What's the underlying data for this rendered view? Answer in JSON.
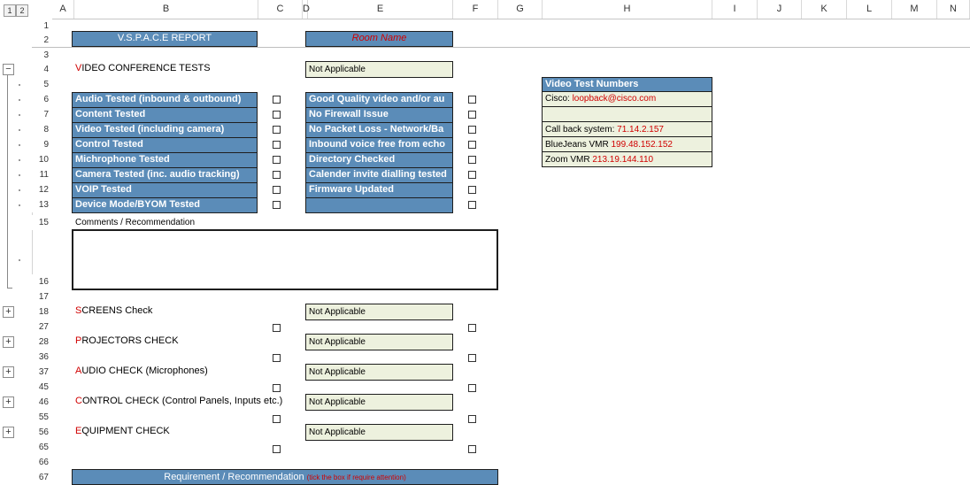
{
  "outline_levels": [
    "1",
    "2"
  ],
  "columns": [
    "A",
    "B",
    "C",
    "D",
    "E",
    "F",
    "G",
    "H",
    "I",
    "J",
    "K",
    "L",
    "M",
    "N"
  ],
  "rows": [
    "1",
    "2",
    "3",
    "4",
    "5",
    "6",
    "7",
    "8",
    "9",
    "10",
    "11",
    "12",
    "13",
    "15",
    "16",
    "17",
    "18",
    "27",
    "28",
    "36",
    "37",
    "45",
    "46",
    "55",
    "56",
    "65",
    "66",
    "67"
  ],
  "report": {
    "title": "V.S.P.A.C.E REPORT",
    "room_name": "Room Name"
  },
  "video_conference": {
    "first_letter": "V",
    "rest": "IDEO CONFERENCE TESTS",
    "status": "Not Applicable",
    "left_items": [
      "Audio Tested (inbound & outbound)",
      "Content Tested",
      "Video Tested (including camera)",
      "Control Tested",
      "Michrophone Tested",
      "Camera Tested (inc. audio tracking)",
      "VOIP Tested",
      "Device Mode/BYOM  Tested"
    ],
    "right_items": [
      "Good Quality video and/or au",
      "No Firewall Issue",
      "No Packet Loss - Network/Ba",
      "Inbound voice free from echo",
      "Directory Checked",
      "Calender invite dialling tested",
      "Firmware Updated",
      ""
    ]
  },
  "comments_label": "Comments / Recommendation",
  "sections": [
    {
      "first": "S",
      "rest": "CREENS Check",
      "status": "Not Applicable"
    },
    {
      "first": "P",
      "rest": "ROJECTORS CHECK",
      "status": "Not Applicable"
    },
    {
      "first": "A",
      "rest": "UDIO CHECK (Microphones)",
      "status": "Not Applicable"
    },
    {
      "first": "C",
      "rest": "ONTROL CHECK (Control Panels, Inputs etc.)",
      "status": "Not Applicable"
    },
    {
      "first": "E",
      "rest": "QUIPMENT CHECK",
      "status": "Not Applicable"
    }
  ],
  "video_test_numbers": {
    "title": "Video Test Numbers",
    "rows": [
      {
        "label": "Cisco: ",
        "value": "loopback@cisco.com"
      },
      {
        "label": "",
        "value": ""
      },
      {
        "label": "Call back system: ",
        "value": "71.14.2.157"
      },
      {
        "label": "BlueJeans VMR ",
        "value": "199.48.152.152"
      },
      {
        "label": "Zoom VMR ",
        "value": "213.19.144.110"
      }
    ]
  },
  "footer": {
    "label": "Requirement / Recommendation",
    "note": "(tick the box if require attention)"
  },
  "colors": {
    "header_blue": "#5b8cb8",
    "field_bg": "#edf1de",
    "accent_red": "#d00000"
  }
}
